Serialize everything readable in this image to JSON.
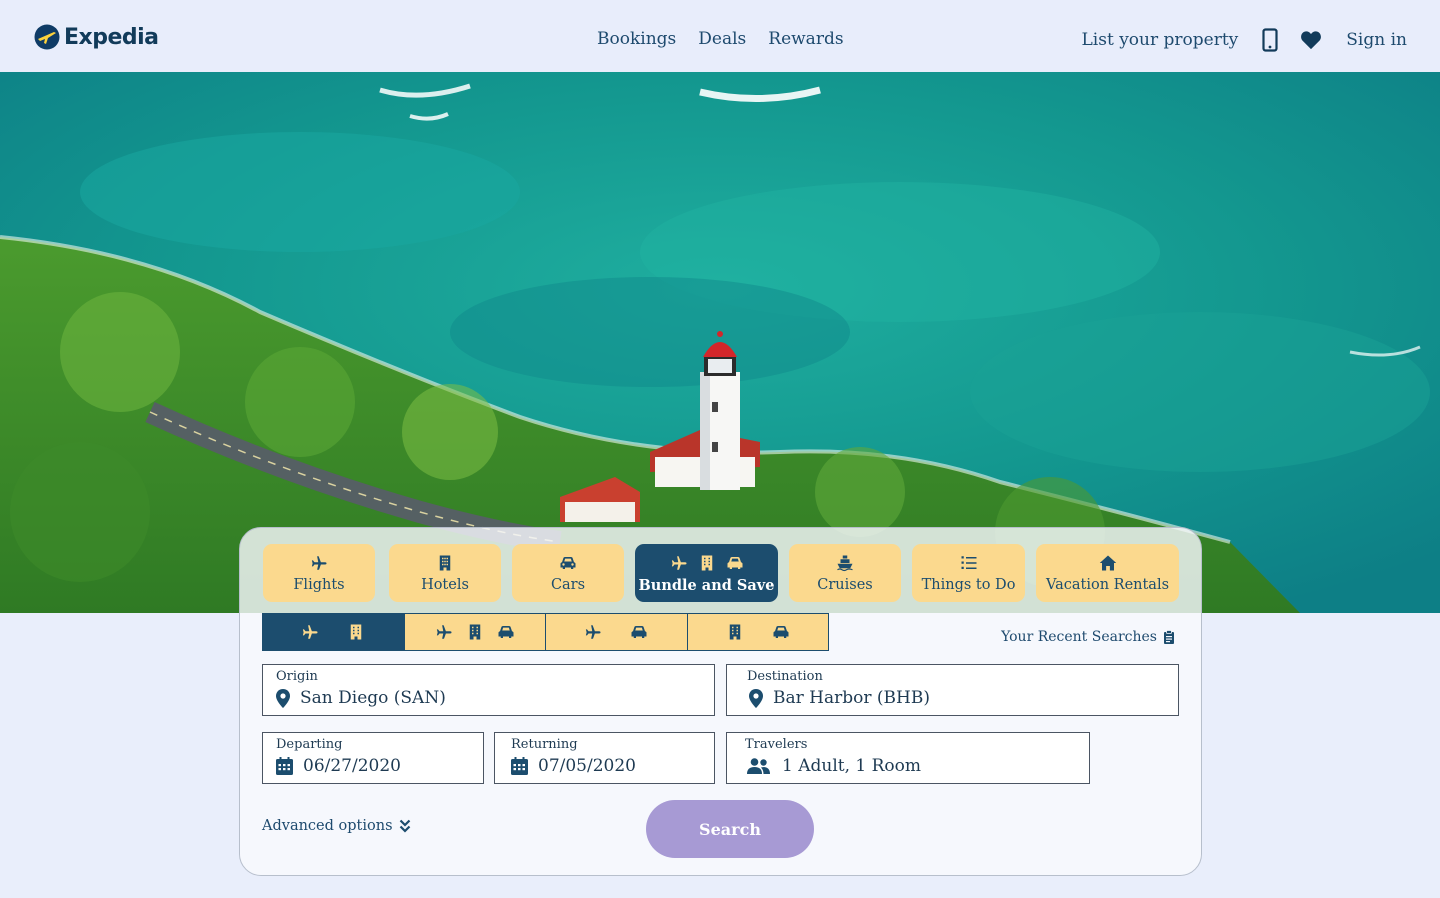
{
  "brand": {
    "name": "Expedia"
  },
  "nav": {
    "bookings": "Bookings",
    "deals": "Deals",
    "rewards": "Rewards"
  },
  "header_right": {
    "list_property": "List your property",
    "sign_in": "Sign in"
  },
  "category_tabs": [
    {
      "label": "Flights",
      "icons": [
        "plane-icon"
      ]
    },
    {
      "label": "Hotels",
      "icons": [
        "building-icon"
      ]
    },
    {
      "label": "Cars",
      "icons": [
        "car-icon"
      ]
    },
    {
      "label": "Bundle and Save",
      "icons": [
        "plane-icon",
        "building-icon",
        "car-icon"
      ],
      "active": true
    },
    {
      "label": "Cruises",
      "icons": [
        "ship-icon"
      ]
    },
    {
      "label": "Things to Do",
      "icons": [
        "list-icon"
      ]
    },
    {
      "label": "Vacation Rentals",
      "icons": [
        "house-icon"
      ]
    }
  ],
  "bundle_options": [
    {
      "icons": [
        "plane-icon",
        "building-icon"
      ],
      "active": true
    },
    {
      "icons": [
        "plane-icon",
        "building-icon",
        "car-icon"
      ]
    },
    {
      "icons": [
        "plane-icon",
        "car-icon"
      ]
    },
    {
      "icons": [
        "building-icon",
        "car-icon"
      ]
    }
  ],
  "recent_searches": "Your Recent Searches",
  "form": {
    "origin": {
      "label": "Origin",
      "value": "San Diego (SAN)"
    },
    "destination": {
      "label": "Destination",
      "value": "Bar Harbor (BHB)"
    },
    "departing": {
      "label": "Departing",
      "value": "06/27/2020"
    },
    "returning": {
      "label": "Returning",
      "value": "07/05/2020"
    },
    "travelers": {
      "label": "Travelers",
      "value": "1 Adult, 1 Room"
    }
  },
  "advanced_options": "Advanced options",
  "search_button": "Search",
  "colors": {
    "primary": "#1c4d6e",
    "tab": "#fbd98e",
    "search": "#a79ad4",
    "header_bg": "#e8edfb"
  }
}
